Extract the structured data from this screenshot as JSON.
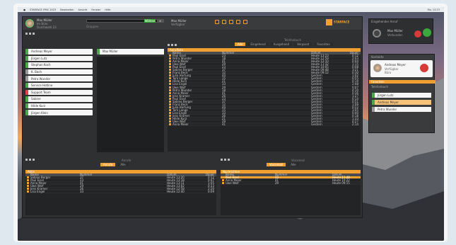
{
  "menubar": {
    "items": [
      "STARFACE iFMC 2023",
      "Bearbeiten",
      "Ansicht",
      "Fenster",
      "Hilfe"
    ],
    "right": "Mo. 13:23"
  },
  "header": {
    "user_name": "Max Müller",
    "user_line2": "Im Büro",
    "user_line3": "Durchwahl 23",
    "call_btn": "Wählen",
    "hang_btn": "x",
    "groups_label": "Gruppen",
    "right_line1": "Max Müller",
    "right_line2": "Verfügbar",
    "logo": "STARFACE"
  },
  "tabs": [
    "Alle",
    "Eingehend",
    "Ausgehend",
    "Verpasst",
    "Favoriten"
  ],
  "phonebook_section": "Telefonbuch",
  "left_contacts": [
    {
      "name": "Andreas Meyer",
      "status": "green"
    },
    {
      "name": "Jürgen Lutz",
      "status": "green"
    },
    {
      "name": "Stephan Koch",
      "status": "green"
    },
    {
      "name": "K. Bach",
      "status": "grey"
    },
    {
      "name": "Petra Wunder",
      "status": "grey"
    },
    {
      "name": "Service Hotline",
      "status": "green"
    },
    {
      "name": "Support Team",
      "status": "red"
    },
    {
      "name": "Sabine",
      "status": "green"
    },
    {
      "name": "Hilde Kurz",
      "status": "green"
    },
    {
      "name": "Jürgen Klein",
      "status": "green"
    }
  ],
  "mid_header": "Max Müller",
  "main_table": {
    "title": "Anrufliste",
    "columns": [
      "Name",
      "Nummer",
      "Datum",
      "Dauer"
    ],
    "rows": [
      {
        "name": "Paul Eisel",
        "num": "23",
        "time": "Heute 13:23",
        "dur": "0:12"
      },
      {
        "name": "Petra Wunder",
        "num": "18",
        "time": "Heute 12:59",
        "dur": "2:03"
      },
      {
        "name": "Anna Meier",
        "num": "41",
        "time": "Heute 12:10",
        "dur": "0:44"
      },
      {
        "name": "Uwe Wolf",
        "num": "29",
        "time": "Heute 11:32",
        "dur": "1:15"
      },
      {
        "name": "Paul Eisel",
        "num": "23",
        "time": "Heute 10:05",
        "dur": "0:08"
      },
      {
        "name": "Sabine Berger",
        "num": "37",
        "time": "Heute 09:48",
        "dur": "3:21"
      },
      {
        "name": "Franz Beck",
        "num": "12",
        "time": "Heute 09:12",
        "dur": "0:30"
      },
      {
        "name": "Julia Hartung",
        "num": "44",
        "time": "Gestern",
        "dur": "1:02"
      },
      {
        "name": "Tom Lange",
        "num": "15",
        "time": "Gestern",
        "dur": "0:55"
      },
      {
        "name": "Hilde Kurz",
        "num": "21",
        "time": "Gestern",
        "dur": "0:19"
      },
      {
        "name": "Lisa Engel",
        "num": "33",
        "time": "Gestern",
        "dur": "2:48"
      },
      {
        "name": "Uwe Wolf",
        "num": "29",
        "time": "Gestern",
        "dur": "0:07"
      },
      {
        "name": "Petra Wunder",
        "num": "18",
        "time": "Gestern",
        "dur": "4:10"
      },
      {
        "name": "Anna Meier",
        "num": "41",
        "time": "Gestern",
        "dur": "0:36"
      },
      {
        "name": "Jens Kramer",
        "num": "26",
        "time": "Gestern",
        "dur": "1:27"
      },
      {
        "name": "Paul Eisel",
        "num": "23",
        "time": "Gestern",
        "dur": "0:14"
      },
      {
        "name": "Sabine Berger",
        "num": "37",
        "time": "Gestern",
        "dur": "0:51"
      },
      {
        "name": "Franz Beck",
        "num": "12",
        "time": "Gestern",
        "dur": "1:09"
      },
      {
        "name": "Julia Hartung",
        "num": "44",
        "time": "Gestern",
        "dur": "0:22"
      },
      {
        "name": "Tom Lange",
        "num": "15",
        "time": "Gestern",
        "dur": "3:05"
      },
      {
        "name": "Lisa Engel",
        "num": "33",
        "time": "Gestern",
        "dur": "0:40"
      },
      {
        "name": "Jens Kramer",
        "num": "26",
        "time": "Gestern",
        "dur": "0:18"
      },
      {
        "name": "Hilde Kurz",
        "num": "21",
        "time": "Gestern",
        "dur": "1:33"
      },
      {
        "name": "Uwe Wolf",
        "num": "29",
        "time": "Gestern",
        "dur": "0:27"
      },
      {
        "name": "Anna Meier",
        "num": "41",
        "time": "Gestern",
        "dur": "2:14"
      }
    ]
  },
  "bottom_left": {
    "section": "Anrufe",
    "tab_on": "Anrufe",
    "tab_off": "Alle",
    "title": "Aktiv",
    "columns": [
      "Name",
      "Nummer",
      "Datum",
      "Dauer"
    ],
    "rows": [
      {
        "name": "Sabine Berger",
        "num": "37",
        "time": "Heute 13:20",
        "dur": "0:12"
      },
      {
        "name": "Paul Eisel",
        "num": "23",
        "time": "Heute 13:18",
        "dur": "0:47"
      },
      {
        "name": "Anna Meier",
        "num": "41",
        "time": "Heute 13:11",
        "dur": "1:05"
      },
      {
        "name": "Uwe Wolf",
        "num": "29",
        "time": "Heute 13:02",
        "dur": "0:33"
      },
      {
        "name": "Jens Kramer",
        "num": "26",
        "time": "Heute 12:58",
        "dur": "2:20"
      },
      {
        "name": "Lisa Engel",
        "num": "33",
        "time": "Heute 12:40",
        "dur": "0:09"
      }
    ]
  },
  "bottom_right": {
    "section": "Voicemail",
    "tab_on": "Voicemail",
    "tab_off": "Alle",
    "title": "Nachrichten",
    "columns": [
      "Name",
      "Nummer",
      "Datum"
    ],
    "rows": [
      {
        "name": "Paul Eisel",
        "num": "23",
        "time": "Heute 11:48",
        "sel": true
      },
      {
        "name": "Anna Meier",
        "num": "41",
        "time": "Heute 10:22",
        "sel": false
      },
      {
        "name": "Uwe Wolf",
        "num": "29",
        "time": "Heute 09:15",
        "sel": false
      }
    ]
  },
  "call_widget": {
    "title": "Eingehender Anruf",
    "name": "Max Müller",
    "sub": "Verbunden"
  },
  "contact_widget": {
    "title": "Kontakte",
    "name": "Andreas Meyer",
    "line2": "Verfügbar",
    "line3": "Büro",
    "list_title": "Favoriten",
    "cards": [
      {
        "name": "Jürgen Lutz",
        "hl": false,
        "grey": false
      },
      {
        "name": "Andreas Meyer",
        "hl": true,
        "grey": false
      },
      {
        "name": "Petra Wunder",
        "hl": false,
        "grey": true
      }
    ]
  }
}
